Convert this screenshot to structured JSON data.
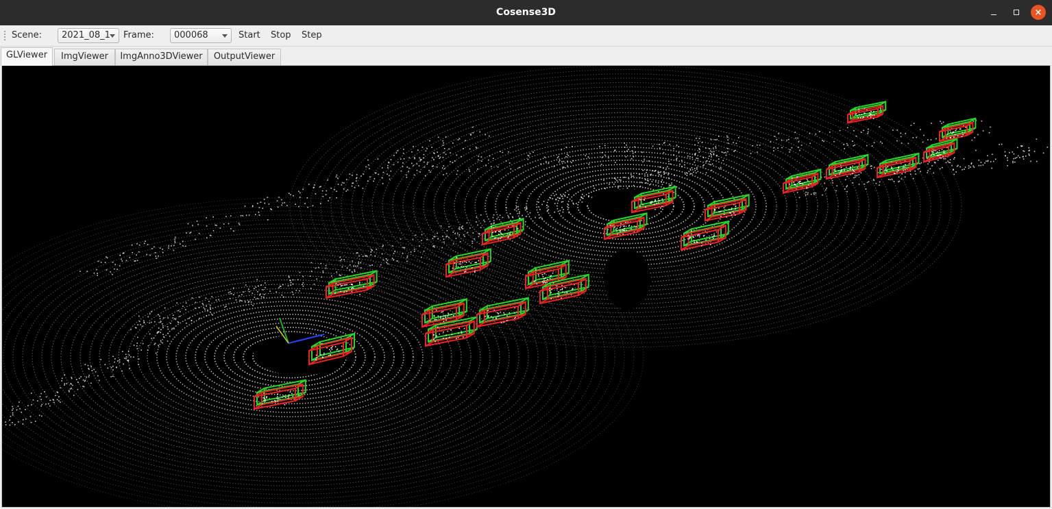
{
  "window": {
    "title": "Cosense3D"
  },
  "toolbar": {
    "scene_label": "Scene:",
    "scene_value": "2021_08_1",
    "frame_label": "Frame:",
    "frame_value": "000068",
    "start_label": "Start",
    "stop_label": "Stop",
    "step_label": "Step"
  },
  "tabs": [
    {
      "label": "GLViewer",
      "active": true
    },
    {
      "label": "ImgViewer",
      "active": false
    },
    {
      "label": "ImgAnno3DViewer",
      "active": false
    },
    {
      "label": "OutputViewer",
      "active": false
    }
  ],
  "viewer": {
    "background_color": "#000000",
    "point_color": "#ffffff",
    "box_colors": {
      "ground_truth": "#22dd22",
      "prediction": "#ee2222"
    }
  }
}
